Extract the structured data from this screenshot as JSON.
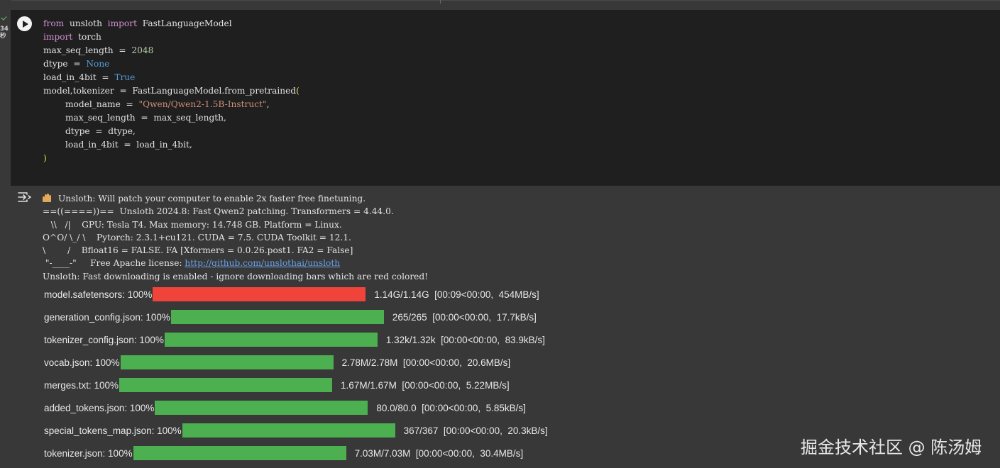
{
  "cell": {
    "status_icon": "check-icon",
    "exec_count": "34\n秒",
    "run_icon": "play-icon",
    "code": {
      "l1": {
        "k1": "from",
        "t1": "unsloth",
        "k2": "import",
        "t2": "FastLanguageModel"
      },
      "l2": {
        "k1": "import",
        "t1": "torch"
      },
      "l3": {
        "t1": "max_seq_length  =  ",
        "n1": "2048"
      },
      "l4": {
        "t1": "dtype  =  ",
        "c1": "None"
      },
      "l5": {
        "t1": "load_in_4bit  =  ",
        "c1": "True"
      },
      "l6": {
        "t1": "model,tokenizer  =  FastLanguageModel.from_pretrained",
        "b1": "("
      },
      "l7": {
        "t1": "model_name  =  ",
        "s1": "\"Qwen/Qwen2-1.5B-Instruct\"",
        "t2": ","
      },
      "l8": {
        "t1": "max_seq_length  =  max_seq_length,"
      },
      "l9": {
        "t1": "dtype  =  dtype,"
      },
      "l10": {
        "t1": "load_in_4bit  =  load_in_4bit,"
      },
      "l11": {
        "b1": ")"
      }
    }
  },
  "output": {
    "icon": "output-toggle-icon",
    "emoji": "waving-hand-icon",
    "lines": [
      "Unsloth: Will patch your computer to enable 2x faster free finetuning.",
      "==((====))==  Unsloth 2024.8: Fast Qwen2 patching. Transformers = 4.44.0.",
      "   \\\\   /|    GPU: Tesla T4. Max memory: 14.748 GB. Platform = Linux.",
      "O^O/ \\_/ \\    Pytorch: 2.3.1+cu121. CUDA = 7.5. CUDA Toolkit = 12.1.",
      "\\        /    Bfloat16 = FALSE. FA [Xformers = 0.0.26.post1. FA2 = False]",
      " \"-____-\"     Free Apache license: ",
      "Unsloth: Fast downloading is enabled - ignore downloading bars which are red colored!"
    ],
    "link": "http://github.com/unslothai/unsloth"
  },
  "downloads": [
    {
      "label": "model.safetensors: 100%",
      "progress": 1.0,
      "color": "#f0443a",
      "stats": "1.14G/1.14G  [00:09<00:00,  454MB/s]"
    },
    {
      "label": "generation_config.json: 100%",
      "progress": 1.0,
      "color": "#4caf50",
      "stats": "265/265  [00:00<00:00,  17.7kB/s]"
    },
    {
      "label": "tokenizer_config.json: 100%",
      "progress": 1.0,
      "color": "#4caf50",
      "stats": "1.32k/1.32k  [00:00<00:00,  83.9kB/s]"
    },
    {
      "label": "vocab.json: 100%",
      "progress": 1.0,
      "color": "#4caf50",
      "stats": "2.78M/2.78M  [00:00<00:00,  20.6MB/s]"
    },
    {
      "label": "merges.txt: 100%",
      "progress": 1.0,
      "color": "#4caf50",
      "stats": "1.67M/1.67M  [00:00<00:00,  5.22MB/s]"
    },
    {
      "label": "added_tokens.json: 100%",
      "progress": 1.0,
      "color": "#4caf50",
      "stats": "80.0/80.0  [00:00<00:00,  5.85kB/s]"
    },
    {
      "label": "special_tokens_map.json: 100%",
      "progress": 1.0,
      "color": "#4caf50",
      "stats": "367/367  [00:00<00:00,  20.3kB/s]"
    },
    {
      "label": "tokenizer.json: 100%",
      "progress": 1.0,
      "color": "#4caf50",
      "stats": "7.03M/7.03M  [00:00<00:00,  30.4MB/s]"
    }
  ],
  "watermark": "掘金技术社区 @ 陈汤姆"
}
